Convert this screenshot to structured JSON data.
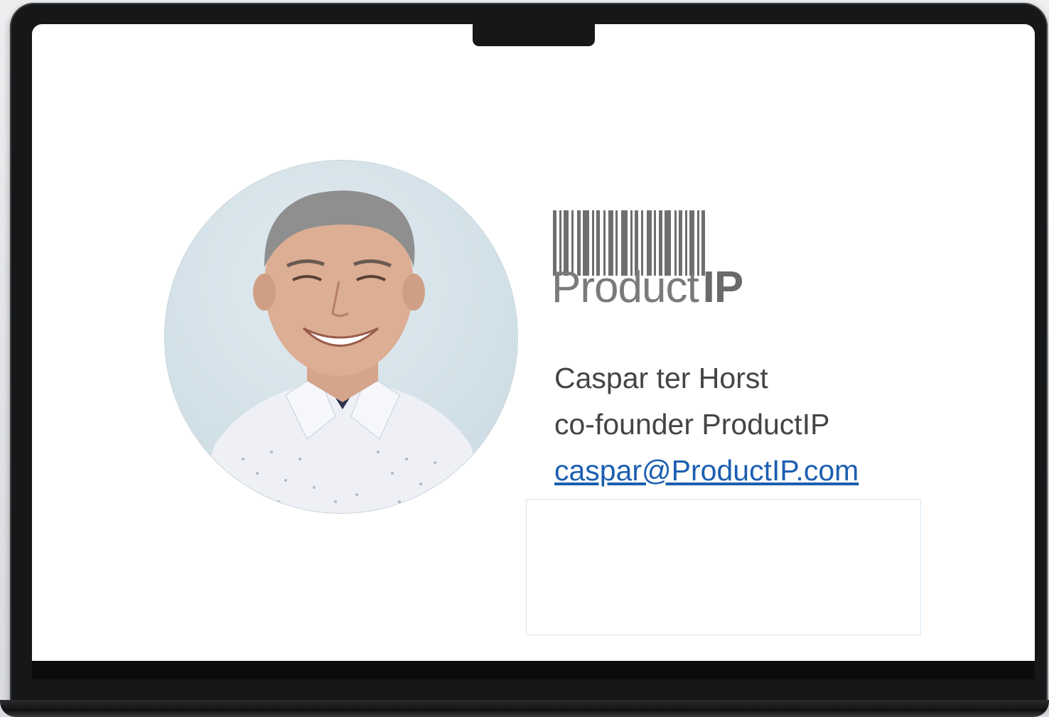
{
  "signature": {
    "name": "Caspar ter Horst",
    "title": "co-founder ProductIP",
    "email": "caspar@ProductIP.com"
  },
  "logo": {
    "word_light": "Product",
    "word_bold": "IP"
  },
  "colors": {
    "link": "#1c5fb0",
    "text": "#444444",
    "logo_gray": "#6e6e6e"
  },
  "icons": {
    "logo": "barcode-logo-icon",
    "avatar": "profile-photo"
  }
}
